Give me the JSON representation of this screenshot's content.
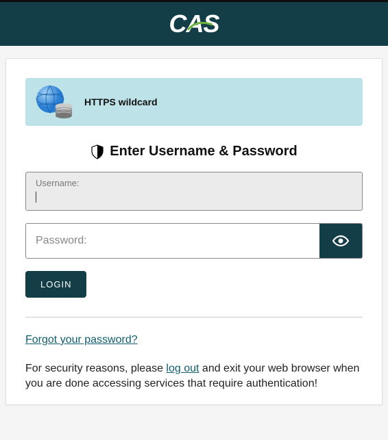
{
  "brand": {
    "name": "CAS"
  },
  "service": {
    "name": "HTTPS wildcard"
  },
  "form": {
    "title": "Enter Username & Password",
    "username_label": "Username:",
    "username_value": "",
    "password_label": "Password:",
    "password_value": "",
    "login_button": "LOGIN"
  },
  "links": {
    "forgot_password": "Forgot your password?",
    "log_out": "log out"
  },
  "messages": {
    "security_prefix": "For security reasons, please ",
    "security_suffix": " and exit your web browser when you are done accessing services that require authentication!"
  },
  "colors": {
    "accent": "#133e48",
    "banner": "#bde2e8"
  }
}
